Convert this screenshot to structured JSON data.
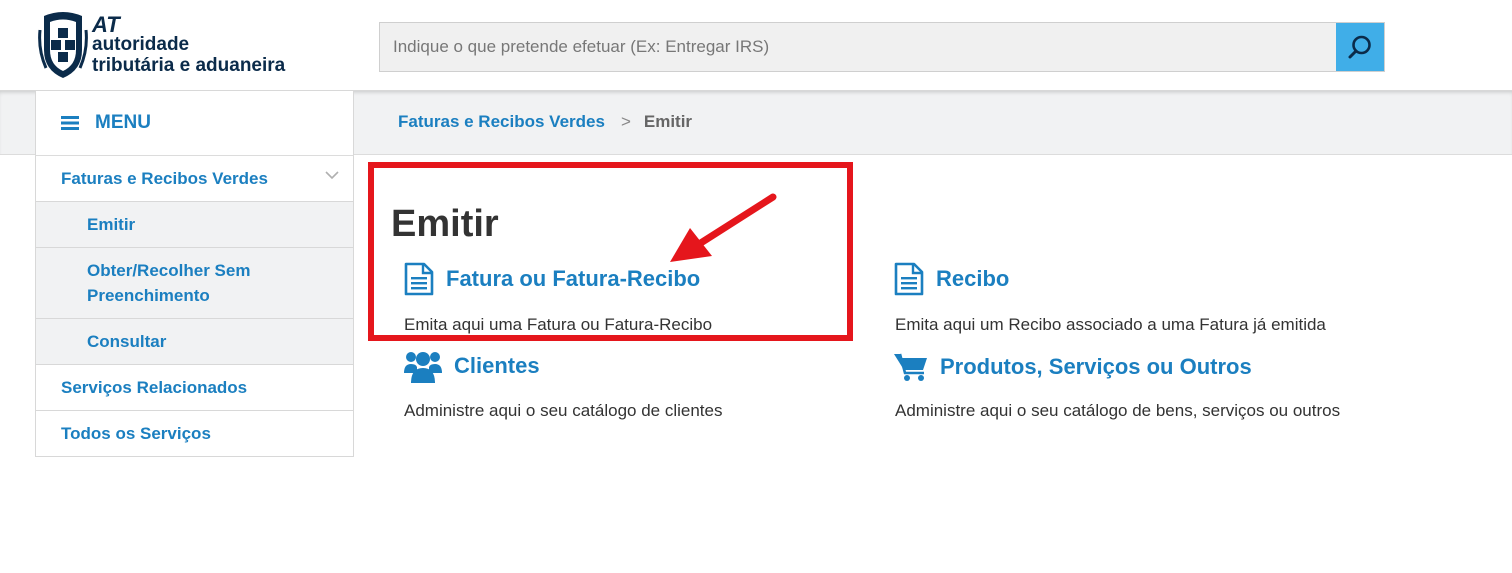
{
  "header": {
    "logo": {
      "at": "AT",
      "line1": "autoridade",
      "line2": "tributária e aduaneira"
    },
    "search": {
      "placeholder": "Indique o que pretende efetuar (Ex: Entregar IRS)",
      "icon": "search-icon"
    }
  },
  "menu": {
    "label": "MENU",
    "icon": "hamburger-icon"
  },
  "breadcrumb": {
    "parent": "Faturas e Recibos Verdes",
    "separator": ">",
    "current": "Emitir"
  },
  "sidebar": {
    "items": [
      {
        "label": "Faturas e Recibos Verdes",
        "expanded": true
      },
      {
        "label": "Emitir"
      },
      {
        "label": "Obter/Recolher Sem",
        "label2": "Preenchimento"
      },
      {
        "label": "Consultar"
      },
      {
        "label": "Serviços Relacionados"
      },
      {
        "label": "Todos os Serviços"
      }
    ]
  },
  "main": {
    "title": "Emitir",
    "cards": [
      {
        "title": "Fatura ou Fatura-Recibo",
        "desc": "Emita aqui uma Fatura ou Fatura-Recibo",
        "icon": "document-icon"
      },
      {
        "title": "Recibo",
        "desc": "Emita aqui um Recibo associado a uma Fatura já emitida",
        "icon": "document-icon"
      },
      {
        "title": "Clientes",
        "desc": "Administre aqui o seu catálogo de clientes",
        "icon": "users-icon"
      },
      {
        "title": "Produtos, Serviços ou Outros",
        "desc": "Administre aqui o seu catálogo de bens, serviços ou outros",
        "icon": "cart-icon"
      }
    ]
  },
  "colors": {
    "brand_blue": "#1b7fc0",
    "search_button": "#40aee8",
    "highlight": "#e5161c",
    "logo_navy": "#0b2b4a"
  }
}
